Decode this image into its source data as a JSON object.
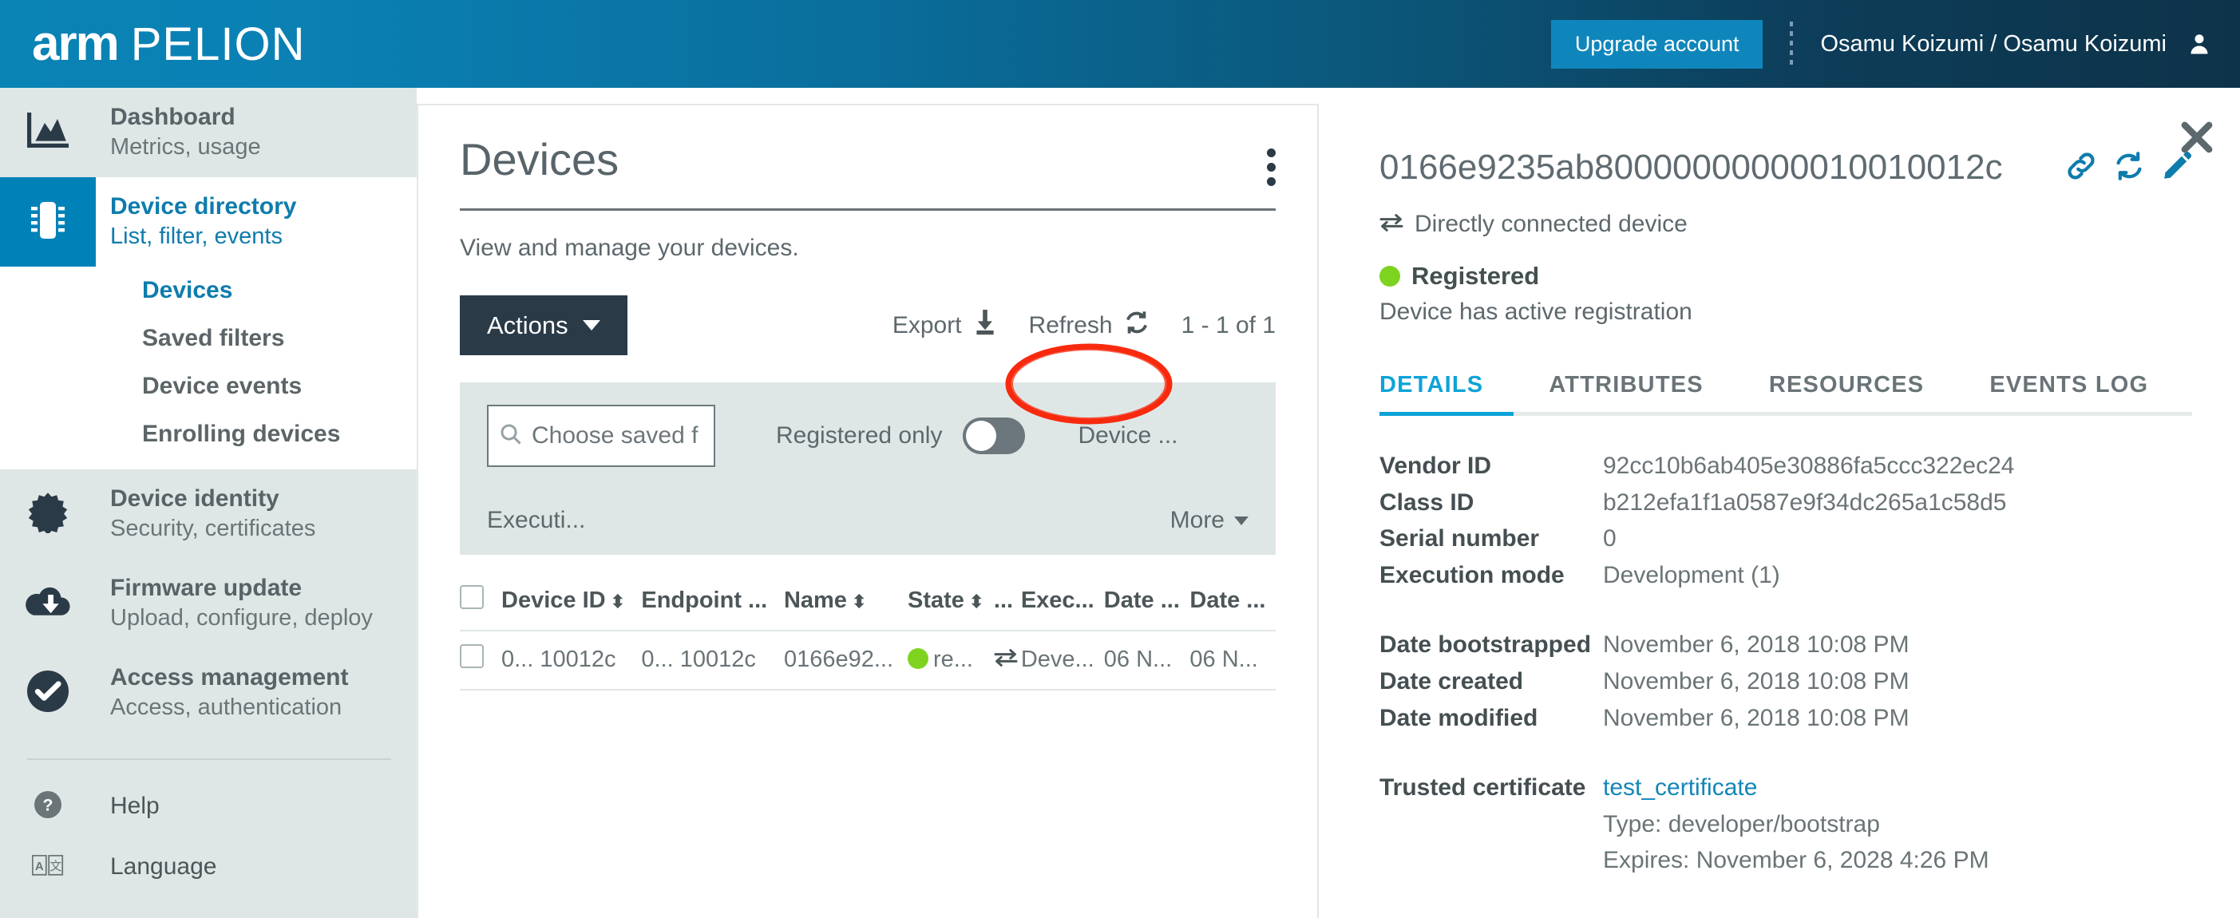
{
  "header": {
    "brand_arm": "arm",
    "brand_pelion": "PELION",
    "upgrade_label": "Upgrade account",
    "account_name": "Osamu Koizumi / Osamu Koizumi",
    "person_icon": "person-icon",
    "colors": {
      "gradient_left": "#0a83b5",
      "gradient_right": "#0d3349",
      "upgrade_bg": "#0f86bb"
    }
  },
  "sidebar": {
    "items": [
      {
        "icon": "chart-icon",
        "title": "Dashboard",
        "sub": "Metrics, usage",
        "active": false
      },
      {
        "icon": "chip-icon",
        "title": "Device directory",
        "sub": "List, filter, events",
        "active": true
      },
      {
        "icon": "badge-icon",
        "title": "Device identity",
        "sub": "Security, certificates",
        "active": false
      },
      {
        "icon": "cloud-down-icon",
        "title": "Firmware update",
        "sub": "Upload, configure, deploy",
        "active": false
      },
      {
        "icon": "check-circle-icon",
        "title": "Access management",
        "sub": "Access, authentication",
        "active": false
      }
    ],
    "subnav": [
      {
        "label": "Devices",
        "selected": true
      },
      {
        "label": "Saved filters",
        "selected": false
      },
      {
        "label": "Device events",
        "selected": false
      },
      {
        "label": "Enrolling devices",
        "selected": false
      }
    ],
    "footer": [
      {
        "icon": "help-icon",
        "label": "Help"
      },
      {
        "icon": "language-icon",
        "label": "Language"
      }
    ],
    "accent_color": "#0082b8"
  },
  "devices_panel": {
    "title": "Devices",
    "kebab_icon": "kebab-menu-icon",
    "subtitle": "View and manage your devices.",
    "actions_label": "Actions",
    "export_label": "Export",
    "export_icon": "download-icon",
    "refresh_label": "Refresh",
    "refresh_icon": "refresh-icon",
    "pagination": "1 - 1 of 1",
    "filters": {
      "search_placeholder": "Choose saved f",
      "search_icon": "search-icon",
      "search_value": "",
      "registered_only_label": "Registered only",
      "registered_only_on": false,
      "device_filter_label": "Device ...",
      "execution_filter_label": "Executi...",
      "more_label": "More"
    },
    "table": {
      "columns": [
        {
          "label": "",
          "sortable": false
        },
        {
          "label": "Device ID",
          "sortable": true
        },
        {
          "label": "Endpoint ...",
          "sortable": false
        },
        {
          "label": "Name",
          "sortable": true
        },
        {
          "label": "State",
          "sortable": true
        },
        {
          "label": "...",
          "sortable": false
        },
        {
          "label": "Exec...",
          "sortable": false
        },
        {
          "label": "Date ...",
          "sortable": false
        },
        {
          "label": "Date ...",
          "sortable": false
        }
      ],
      "rows": [
        {
          "device_id": "0... 10012c",
          "endpoint": "0... 10012c",
          "name": "0166e92...",
          "state": "re...",
          "state_color": "#7ed321",
          "conn_icon": "exchange-icon",
          "exec": "Deve...",
          "date1": "06 N...",
          "date2": "06 N..."
        }
      ]
    }
  },
  "detail_panel": {
    "close_icon": "close-icon",
    "device_id": "0166e9235ab80000000000010010012c",
    "icons": [
      "link-icon",
      "sync-icon",
      "edit-icon"
    ],
    "connection_icon": "exchange-icon",
    "connection_label": "Directly connected device",
    "status_label": "Registered",
    "status_desc": "Device has active registration",
    "status_color": "#7ed321",
    "tabs": [
      {
        "label": "DETAILS",
        "active": true
      },
      {
        "label": "ATTRIBUTES",
        "active": false
      },
      {
        "label": "RESOURCES",
        "active": false,
        "annotated": true
      },
      {
        "label": "EVENTS LOG",
        "active": false
      }
    ],
    "annotation_color": "#f82a0e",
    "fields_group1": [
      {
        "key": "Vendor ID",
        "value": "92cc10b6ab405e30886fa5ccc322ec24"
      },
      {
        "key": "Class ID",
        "value": "b212efa1f1a0587e9f34dc265a1c58d5"
      },
      {
        "key": "Serial number",
        "value": "0"
      },
      {
        "key": "Execution mode",
        "value": "Development (1)"
      }
    ],
    "fields_group2": [
      {
        "key": "Date bootstrapped",
        "value": "November 6, 2018 10:08 PM"
      },
      {
        "key": "Date created",
        "value": "November 6, 2018 10:08 PM"
      },
      {
        "key": "Date modified",
        "value": "November 6, 2018 10:08 PM"
      }
    ],
    "certificate": {
      "key": "Trusted certificate",
      "link": "test_certificate",
      "type": "Type: developer/bootstrap",
      "expires": "Expires: November 6, 2028 4:26 PM"
    }
  }
}
